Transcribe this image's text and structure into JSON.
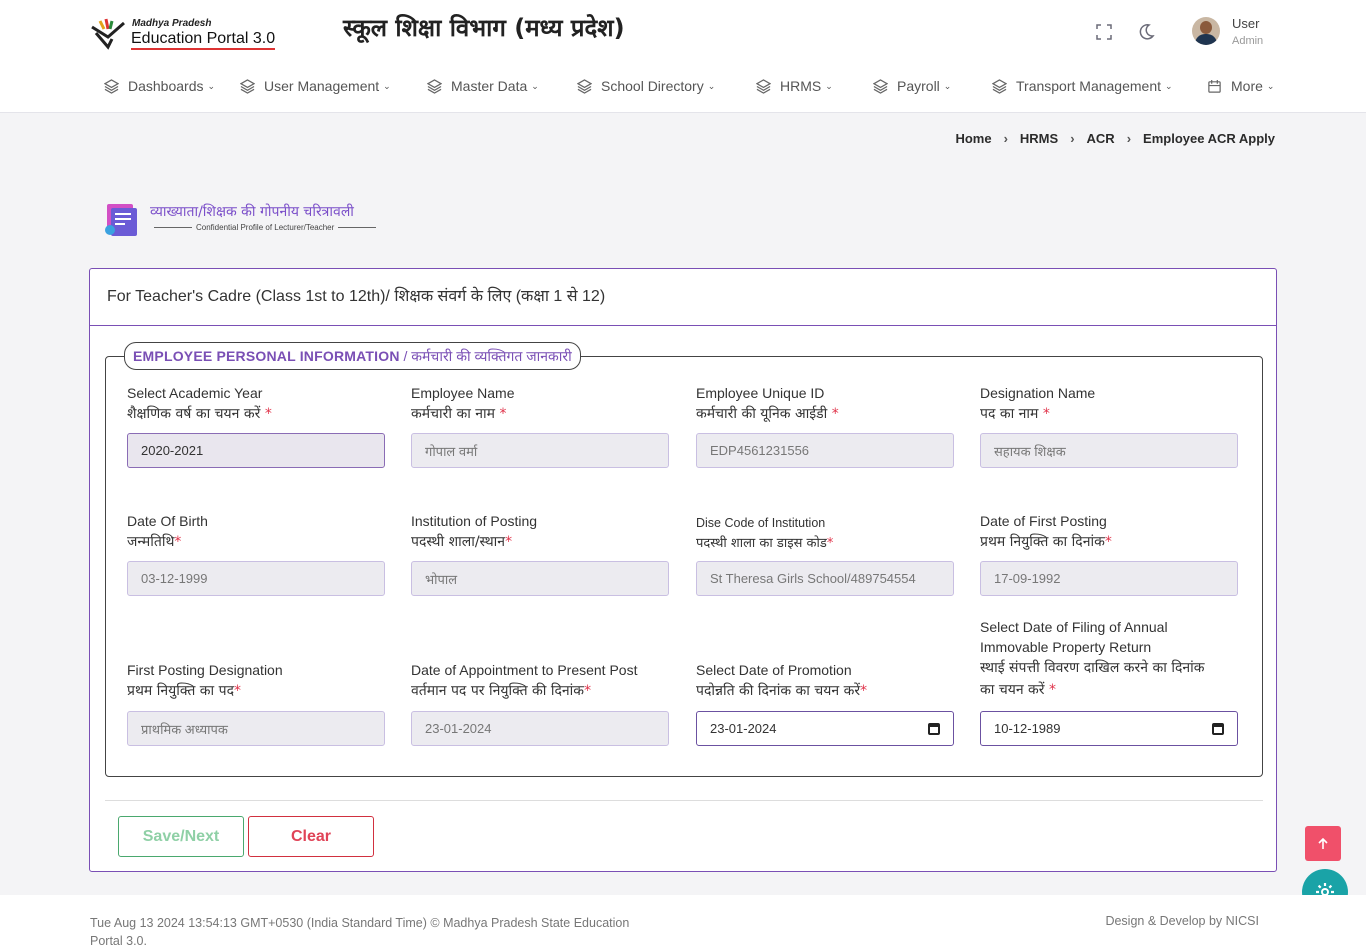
{
  "header": {
    "logo_line1": "Madhya Pradesh",
    "logo_line2": "Education Portal 3.0",
    "dept_title": "स्कूल शिक्षा विभाग (मध्य प्रदेश)",
    "user_name": "User",
    "user_role": "Admin"
  },
  "nav": [
    {
      "label": "Dashboards"
    },
    {
      "label": "User Management"
    },
    {
      "label": "Master Data"
    },
    {
      "label": "School Directory"
    },
    {
      "label": "HRMS"
    },
    {
      "label": "Payroll"
    },
    {
      "label": "Transport Management"
    },
    {
      "label": "More"
    }
  ],
  "breadcrumb": [
    "Home",
    "HRMS",
    "ACR",
    "Employee ACR Apply"
  ],
  "page_heading": {
    "hindi": "व्याख्याता/शिक्षक की गोपनीय चरित्रावली",
    "english": "Confidential Profile of Lecturer/Teacher"
  },
  "card": {
    "title": "For Teacher's Cadre (Class 1st to 12th)/ शिक्षक संवर्ग के लिए (कक्षा 1 से 12)",
    "legend_en": "EMPLOYEE PERSONAL INFORMATION",
    "legend_hi": " / कर्मचारी की व्यक्तिगत जानकारी"
  },
  "fields": {
    "academic_year": {
      "en": "Select Academic Year",
      "hi": "शैक्षणिक वर्ष का चयन करें",
      "value": "2020-2021"
    },
    "employee_name": {
      "en": "Employee Name",
      "hi": "कर्मचारी का नाम",
      "value": "गोपाल वर्मा"
    },
    "employee_id": {
      "en": "Employee Unique ID",
      "hi": "कर्मचारी की यूनिक आईडी",
      "value": "EDP4561231556"
    },
    "designation": {
      "en": "Designation Name",
      "hi": "पद का नाम",
      "value": "सहायक शिक्षक"
    },
    "dob": {
      "en": "Date Of Birth",
      "hi": "जन्मतिथि",
      "value": "03-12-1999"
    },
    "institution": {
      "en": "Institution of Posting",
      "hi": "पदस्थी शाला/स्थान",
      "value": "भोपाल"
    },
    "dise_code": {
      "en": "Dise Code of Institution",
      "hi": "पदस्थी शाला का डाइस कोड",
      "value": "St Theresa Girls School/489754554"
    },
    "first_posting_date": {
      "en": "Date of First Posting",
      "hi": "प्रथम नियुक्ति का दिनांक",
      "value": "17-09-1992"
    },
    "first_posting_designation": {
      "en": "First Posting Designation",
      "hi": "प्रथम नियुक्ति का पद",
      "value": "प्राथमिक अध्यापक"
    },
    "appointment_date": {
      "en": "Date of Appointment to Present Post",
      "hi": "वर्तमान पद पर नियुक्ति की दिनांक",
      "value": "23-01-2024"
    },
    "promotion_date": {
      "en": "Select Date of Promotion",
      "hi": "पदोन्नति की दिनांक का चयन करें",
      "value": "23-01-2024"
    },
    "property_return_date": {
      "en1": "Select Date of Filing of Annual",
      "en2": "Immovable Property Return",
      "hi1": "स्थाई संपत्ती विवरण दाखिल करने का दिनांक",
      "hi2": "का चयन करें",
      "value": "10-12-1989"
    }
  },
  "buttons": {
    "save": "Save/Next",
    "clear": "Clear"
  },
  "footer": {
    "left": "Tue Aug 13 2024 13:54:13 GMT+0530 (India Standard Time) © Madhya Pradesh State Education Portal 3.0.",
    "right": "Design & Develop by NICSI"
  },
  "icons": [
    "layers-icon",
    "fullscreen-icon",
    "moon-icon",
    "calendar-icon",
    "arrow-up-icon",
    "gear-icon"
  ],
  "colors": {
    "accent": "#7a4fb5",
    "danger": "#e0334a",
    "success": "#4aa86e",
    "teal": "#1aa3a7"
  }
}
